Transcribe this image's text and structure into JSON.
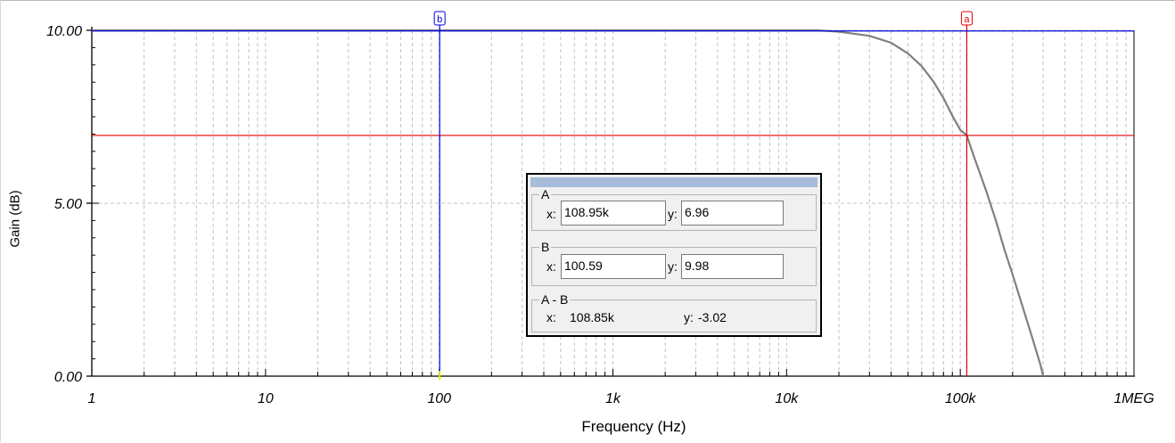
{
  "chart_data": {
    "type": "line",
    "xlabel": "Frequency (Hz)",
    "ylabel": "Gain (dB)",
    "x_scale": "log",
    "xlim": [
      1,
      1000000
    ],
    "ylim": [
      0,
      10
    ],
    "xticks": [
      "1",
      "10",
      "100",
      "1k",
      "10k",
      "100k",
      "1MEG"
    ],
    "yticks": [
      "0.00",
      "5.00",
      "10.00"
    ],
    "grid": true,
    "series": [
      {
        "color": "#808080",
        "x": [
          1,
          10,
          100,
          1000,
          10000,
          15000,
          20000,
          30000,
          40000,
          50000,
          60000,
          70000,
          80000,
          90000,
          100000,
          108950,
          120000,
          140000,
          160000,
          180000,
          200000,
          230000,
          260000,
          290000,
          300000
        ],
        "y": [
          10.0,
          10.0,
          10.0,
          10.0,
          10.0,
          10.0,
          9.96,
          9.84,
          9.64,
          9.33,
          8.96,
          8.52,
          8.04,
          7.53,
          7.12,
          6.96,
          6.34,
          5.4,
          4.51,
          3.64,
          2.94,
          1.96,
          1.1,
          0.31,
          0.0
        ]
      }
    ],
    "cursors": [
      {
        "label": "a",
        "x": 108950,
        "y": 6.96,
        "color": "#e00000"
      },
      {
        "label": "b",
        "x": 100.59,
        "y": 9.98,
        "color": "#0000e0"
      }
    ]
  },
  "cursor_box": {
    "a": {
      "title": "A",
      "x_label": "x:",
      "x": "108.95k",
      "y_label": "y:",
      "y": "6.96"
    },
    "b": {
      "title": "B",
      "x_label": "x:",
      "x": "100.59",
      "y_label": "y:",
      "y": "9.98"
    },
    "diff": {
      "title": "A - B",
      "x_label": "x:",
      "x": "108.85k",
      "y_label": "y:",
      "y": "-3.02"
    }
  }
}
